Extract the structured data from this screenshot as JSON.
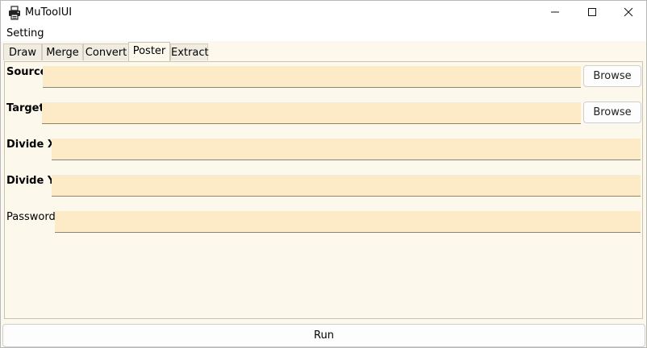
{
  "window": {
    "title": "MuToolUI",
    "icon": "printer-app-icon",
    "controls": [
      "minimize-icon",
      "maximize-icon",
      "close-icon"
    ]
  },
  "menu": {
    "items": [
      {
        "label": "Setting"
      }
    ]
  },
  "tabs": [
    {
      "label": "Draw",
      "active": false
    },
    {
      "label": "Merge",
      "active": false
    },
    {
      "label": "Convert",
      "active": false
    },
    {
      "label": "Poster",
      "active": true
    },
    {
      "label": "Extract",
      "active": false
    }
  ],
  "form": {
    "source": {
      "label": "Source:",
      "value": "",
      "browse_label": "Browse"
    },
    "target": {
      "label": "Target:",
      "value": "",
      "browse_label": "Browse"
    },
    "divide_x": {
      "label": "Divide X:",
      "value": ""
    },
    "divide_y": {
      "label": "Divide Y:",
      "value": ""
    },
    "password": {
      "label": "Password:",
      "value": ""
    }
  },
  "run_label": "Run",
  "colors": {
    "field_bg": "#fdeac6",
    "pane_bg": "#fdf8ec"
  }
}
